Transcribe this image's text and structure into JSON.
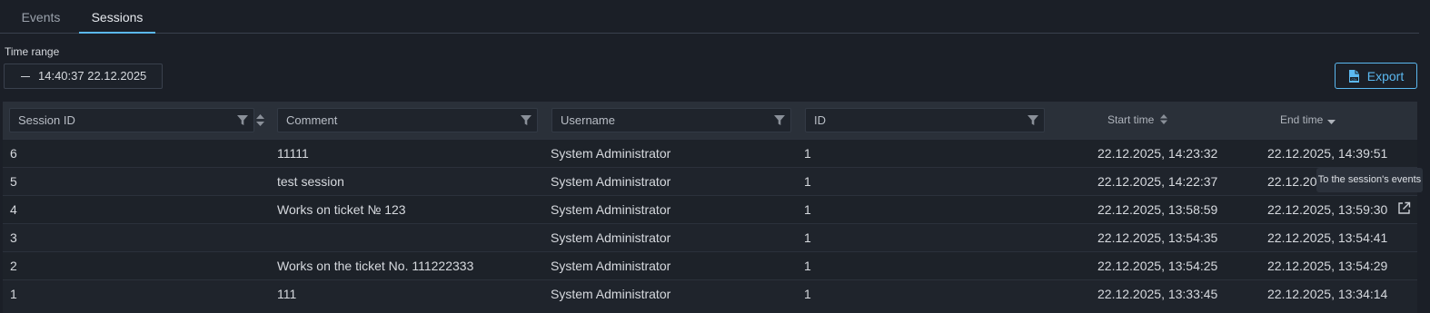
{
  "tabs": [
    {
      "label": "Events",
      "active": false
    },
    {
      "label": "Sessions",
      "active": true
    }
  ],
  "filters": {
    "time_range_label": "Time range",
    "time_range_value": "14:40:37 22.12.2025"
  },
  "toolbar": {
    "export_label": "Export",
    "export_icon": "csv-file-icon"
  },
  "table": {
    "columns": [
      "Session ID",
      "Comment",
      "Username",
      "ID",
      "Start time",
      "End time"
    ],
    "rows": [
      {
        "session_id": "6",
        "comment": "11111",
        "username": "System Administrator",
        "id": "1",
        "start": "22.12.2025, 14:23:32",
        "end": "22.12.2025, 14:39:51"
      },
      {
        "session_id": "5",
        "comment": "test session",
        "username": "System Administrator",
        "id": "1",
        "start": "22.12.2025, 14:22:37",
        "end": "22.12.20"
      },
      {
        "session_id": "4",
        "comment": "Works on ticket № 123",
        "username": "System Administrator",
        "id": "1",
        "start": "22.12.2025, 13:58:59",
        "end": "22.12.2025, 13:59:30"
      },
      {
        "session_id": "3",
        "comment": "",
        "username": "System Administrator",
        "id": "1",
        "start": "22.12.2025, 13:54:35",
        "end": "22.12.2025, 13:54:41"
      },
      {
        "session_id": "2",
        "comment": "Works on the ticket No. 111222333",
        "username": "System Administrator",
        "id": "1",
        "start": "22.12.2025, 13:54:25",
        "end": "22.12.2025, 13:54:29"
      },
      {
        "session_id": "1",
        "comment": "111",
        "username": "System Administrator",
        "id": "1",
        "start": "22.12.2025, 13:33:45",
        "end": "22.12.2025, 13:34:14"
      }
    ]
  },
  "tooltip": {
    "text": "To the session's events"
  },
  "colors": {
    "accent": "#5bb8f0",
    "background": "#1b1f27",
    "header": "#2a3039"
  }
}
